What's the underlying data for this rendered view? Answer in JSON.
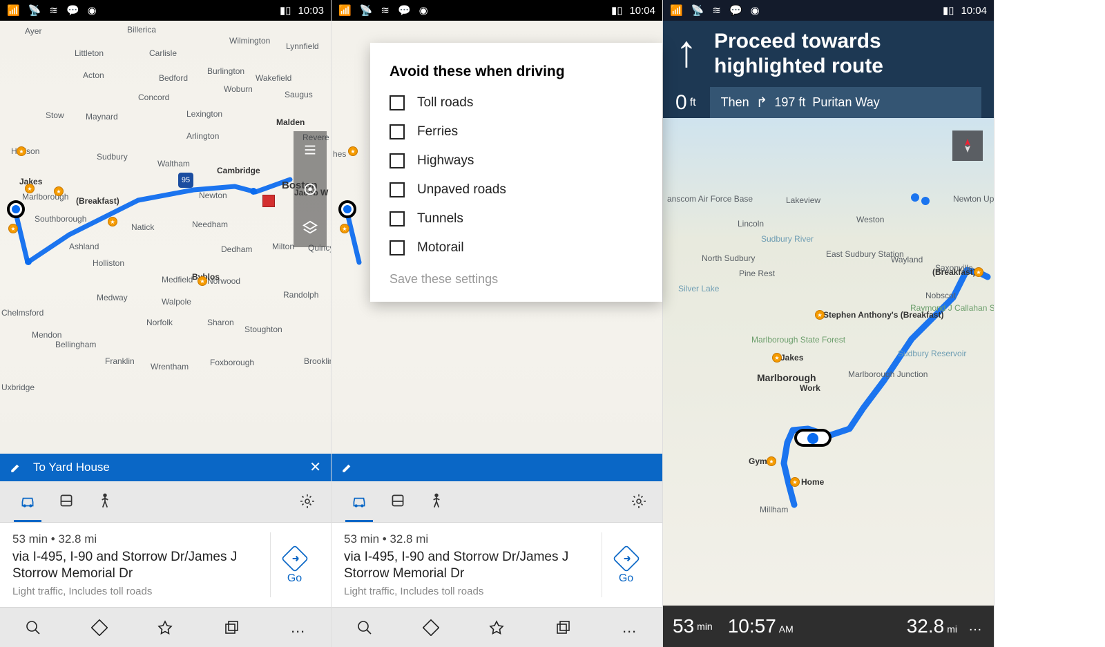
{
  "status": {
    "time1": "10:03",
    "time2": "10:04",
    "time3": "10:04"
  },
  "routeBar": {
    "destination": "To Yard House"
  },
  "route": {
    "meta": "53 min  •  32.8 mi",
    "via": "via I-495, I-90 and Storrow Dr/James J Storrow Memorial Dr",
    "traffic": "Light traffic, Includes toll roads",
    "go": "Go"
  },
  "dialog": {
    "title": "Avoid these when driving",
    "options": [
      "Toll roads",
      "Ferries",
      "Highways",
      "Unpaved roads",
      "Tunnels",
      "Motorail"
    ],
    "save": "Save these settings"
  },
  "navHeader": {
    "instruction": "Proceed towards highlighted route",
    "distValue": "0",
    "distUnit": "ft",
    "thenLabel": "Then",
    "thenDist": "197 ft",
    "thenStreet": "Puritan Way"
  },
  "navFooter": {
    "eta_min": "53",
    "eta_unit": "min",
    "clock_time": "10:57",
    "clock_ampm": "AM",
    "dist_val": "32.8",
    "dist_unit": "mi"
  },
  "map1": {
    "cities": [
      "Ayer",
      "Billerica",
      "Littleton",
      "Carlisle",
      "Wilmington",
      "Lynnfield",
      "Acton",
      "Bedford",
      "Burlington",
      "Wakefield",
      "Concord",
      "Woburn",
      "Saugus",
      "Stow",
      "Maynard",
      "Lexington",
      "Arlington",
      "Malden",
      "Hudson",
      "Sudbury",
      "Waltham",
      "Cambridge",
      "Boston",
      "Marlborough",
      "Newton",
      "Southborough",
      "Natick",
      "Needham",
      "Milton",
      "Ashland",
      "Dedham",
      "Holliston",
      "Medfield",
      "Norwood",
      "Randolph",
      "Medway",
      "Walpole",
      "Stoughton",
      "Mendon",
      "Norfolk",
      "Sharon",
      "Bellingham",
      "Franklin",
      "Wrentham",
      "Foxborough",
      "Uxbridge",
      "Revere",
      "Byblos",
      "Quincy",
      "Brookline",
      "Chelmsford"
    ],
    "annotations": [
      "(Breakfast)",
      "Jakes",
      "Jacob W"
    ],
    "highway": "95"
  },
  "map3": {
    "labels": [
      "anscom Air Force Base",
      "Lakeview",
      "Weston",
      "Newton Upper F",
      "Lincoln",
      "Sudbury River",
      "North Sudbury",
      "Pine Rest",
      "East Sudbury Station",
      "Wayland",
      "Saxonville",
      "(Breakfast)",
      "Silver Lake",
      "Nobscot",
      "Stephen Anthony's (Breakfast)",
      "Raymond J Callahan State Park",
      "Marlborough State Forest",
      "Jakes",
      "Sudbury Reservoir",
      "Marlborough",
      "Marlborough Junction",
      "Work",
      "Gym",
      "Home",
      "Millham"
    ]
  }
}
